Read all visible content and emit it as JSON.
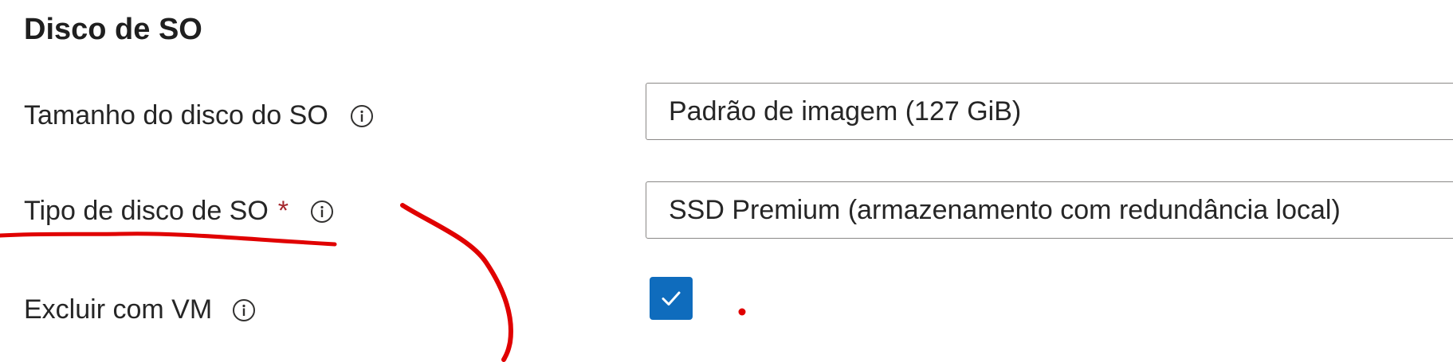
{
  "section": {
    "title": "Disco de SO"
  },
  "fields": {
    "os_disk_size": {
      "label": "Tamanho do disco do SO",
      "value": "Padrão de imagem (127 GiB)"
    },
    "os_disk_type": {
      "label": "Tipo de disco de SO",
      "required_marker": "*",
      "value": "SSD Premium (armazenamento com redundância local)"
    },
    "delete_with_vm": {
      "label": "Excluir com VM",
      "checked": true
    }
  },
  "colors": {
    "checkbox_fill": "#0f6cbd",
    "required_marker": "#a4262c",
    "annotation_red": "#e00000"
  },
  "icons": {
    "info": "info-circle-icon",
    "check": "checkmark-icon"
  }
}
